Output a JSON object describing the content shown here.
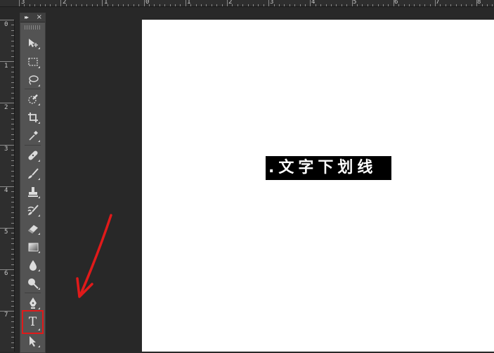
{
  "rulers": {
    "top_numbers": [
      "3",
      "2",
      "1",
      "0",
      "1",
      "2",
      "3",
      "4",
      "5",
      "6",
      "7",
      "8"
    ],
    "left_numbers": [
      "0",
      "1",
      "2",
      "3",
      "4",
      "5",
      "6",
      "7"
    ]
  },
  "toolbox": {
    "collapse_glyph": "▸▸",
    "close_glyph": "×",
    "tools": [
      {
        "name": "move-tool",
        "icon": "move-icon"
      },
      {
        "name": "rectangular-marquee-tool",
        "icon": "marquee-icon"
      },
      {
        "name": "lasso-tool",
        "icon": "lasso-icon"
      },
      {
        "name": "quick-selection-tool",
        "icon": "quick-selection-icon"
      },
      {
        "name": "crop-tool",
        "icon": "crop-icon"
      },
      {
        "name": "eyedropper-tool",
        "icon": "eyedropper-icon"
      },
      {
        "name": "healing-brush-tool",
        "icon": "bandage-icon"
      },
      {
        "name": "brush-tool",
        "icon": "brush-icon"
      },
      {
        "name": "clone-stamp-tool",
        "icon": "stamp-icon"
      },
      {
        "name": "history-brush-tool",
        "icon": "history-brush-icon"
      },
      {
        "name": "eraser-tool",
        "icon": "eraser-icon"
      },
      {
        "name": "gradient-tool",
        "icon": "gradient-icon"
      },
      {
        "name": "blur-tool",
        "icon": "drop-icon"
      },
      {
        "name": "dodge-tool",
        "icon": "dodge-icon"
      },
      {
        "name": "pen-tool",
        "icon": "pen-icon"
      },
      {
        "name": "type-tool",
        "icon": "type-icon",
        "glyph": "T",
        "highlighted": true
      },
      {
        "name": "path-selection-tool",
        "icon": "path-select-icon"
      }
    ]
  },
  "document": {
    "text_layer": ".文字下划线"
  },
  "annotation": {
    "arrow_color": "#e01a1a",
    "highlight_color": "#e01a1a"
  }
}
